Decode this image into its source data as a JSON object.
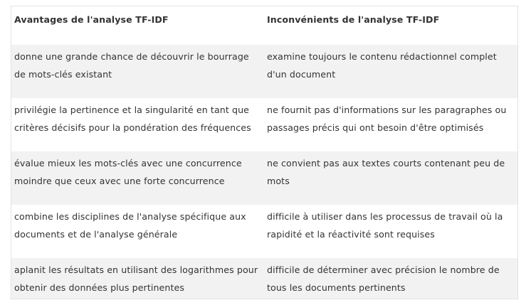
{
  "table": {
    "headers": [
      "Avantages de l'analyse TF-IDF",
      "Inconvénients de l'analyse TF-IDF"
    ],
    "rows": [
      [
        "donne une grande chance de découvrir le bourrage de mots-clés existant",
        "examine toujours le contenu rédactionnel complet d'un document"
      ],
      [
        "privilégie la pertinence et la singularité en tant que critères décisifs pour la pondération des fréquences",
        "ne fournit pas d'informations sur les paragraphes ou passages précis qui ont besoin d'être optimisés"
      ],
      [
        "évalue mieux les mots-clés avec une concurrence moindre que ceux avec une forte concurrence",
        "ne convient pas aux textes courts contenant peu de mots"
      ],
      [
        "combine les disciplines de l'analyse spécifique aux documents et de l'analyse générale",
        "difficile à utiliser dans les processus de travail où la rapidité et la réactivité sont requises"
      ],
      [
        "aplanit les résultats en utilisant des logarithmes pour obtenir des données plus pertinentes",
        "difficile de déterminer avec précision le nombre de tous les documents pertinents"
      ]
    ]
  }
}
